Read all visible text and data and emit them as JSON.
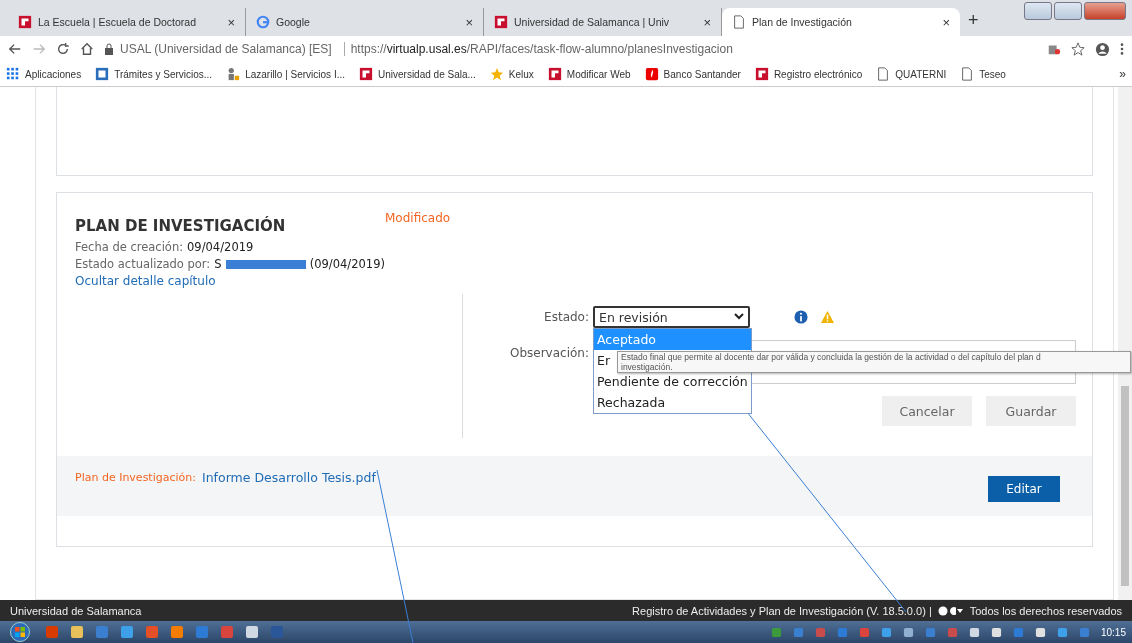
{
  "browser": {
    "tabs": [
      {
        "title": "La Escuela | Escuela de Doctorad",
        "kind": "usal",
        "close": "×",
        "selected": false
      },
      {
        "title": "Google",
        "kind": "google",
        "close": "×",
        "selected": false
      },
      {
        "title": "Universidad de Salamanca | Univ",
        "kind": "usal",
        "close": "×",
        "selected": false
      },
      {
        "title": "Plan de Investigación",
        "kind": "page",
        "close": "×",
        "selected": true
      }
    ],
    "new_tab": "+",
    "site_info": "USAL (Universidad de Salamanca) [ES]",
    "url": "https://**virtualp.usal.es**/RAPI/faces/task-flow-alumno/planesInvestigacion",
    "bookmarks": [
      {
        "label": "Aplicaciones",
        "kind": "apps"
      },
      {
        "label": "Trámites y Servicios...",
        "kind": "form"
      },
      {
        "label": "Lazarillo | Servicios I...",
        "kind": "person"
      },
      {
        "label": "Universidad de Sala...",
        "kind": "usal"
      },
      {
        "label": "Kelux",
        "kind": "star"
      },
      {
        "label": "Modificar Web",
        "kind": "usal"
      },
      {
        "label": "Banco Santander",
        "kind": "bank"
      },
      {
        "label": "Registro electrónico",
        "kind": "usal"
      },
      {
        "label": "QUATERNI",
        "kind": "page"
      },
      {
        "label": "Teseo",
        "kind": "page"
      }
    ],
    "bookmarks_more": "»"
  },
  "plan": {
    "title": "PLAN DE INVESTIGACIÓN",
    "status": "Modificado",
    "created_label": "Fecha de creación:",
    "created_value": "09/04/2019",
    "updated_label": "Estado actualizado por:",
    "updated_initial": "S",
    "updated_date": "(09/04/2019)",
    "toggle_link": "Ocultar detalle capítulo",
    "form": {
      "estado_label": "Estado:",
      "estado_value": "En revisión",
      "options": [
        {
          "label": "Aceptado",
          "selected": true
        },
        {
          "label": "Er",
          "selected": false
        },
        {
          "label": "Pendiente de corrección",
          "selected": false
        },
        {
          "label": "Rechazada",
          "selected": false
        }
      ],
      "tooltip": "Estado final que permite al docente dar por válida y concluida la gestión de la actividad o del capítulo del plan d",
      "tooltip_line2": "investigación.",
      "observacion_label": "Observación:",
      "buttons": [
        "Cancelar",
        "Guardar"
      ]
    },
    "attachment_label": "Plan de Investigación:",
    "attachment_file": "Informe Desarrollo Tesis.pdf",
    "edit_button": "Editar"
  },
  "footer": {
    "left": "Universidad de Salamanca",
    "right": "Registro de Actividades y Plan de Investigación (V. 18.5.0.0) |",
    "rights": "Todos los derechos reservados"
  },
  "taskbar": {
    "clock": "10:15"
  }
}
